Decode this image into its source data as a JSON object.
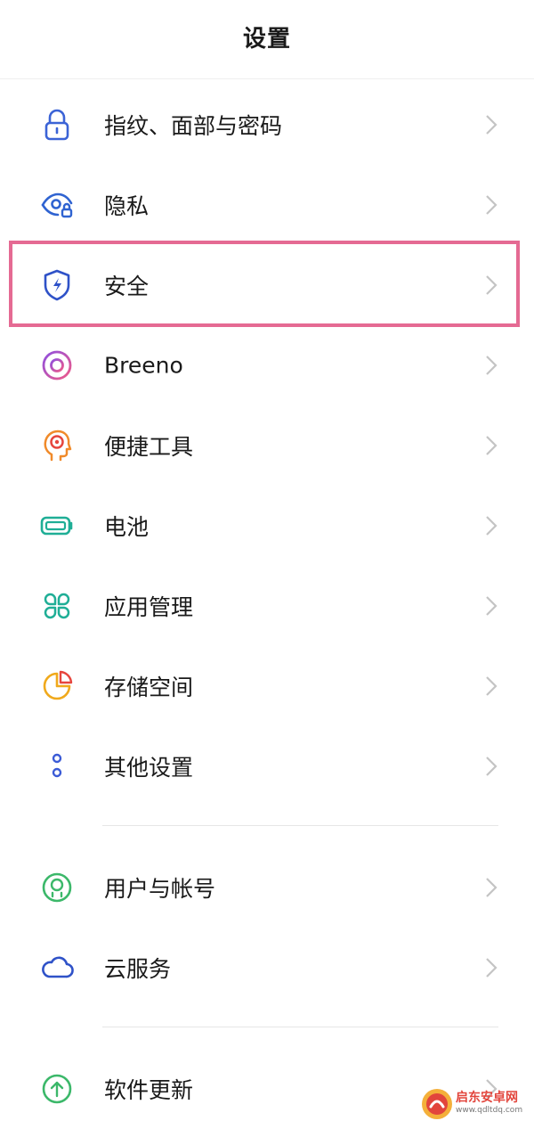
{
  "header": {
    "title": "设置"
  },
  "settings": {
    "items": [
      {
        "label": "指纹、面部与密码",
        "icon": "lock-icon",
        "color": "#3b63d6"
      },
      {
        "label": "隐私",
        "icon": "privacy-eye-icon",
        "color": "#2f63d1"
      },
      {
        "label": "安全",
        "icon": "shield-icon",
        "color": "#2f52c8"
      },
      {
        "label": "Breeno",
        "icon": "breeno-icon",
        "color": "#d94fa1"
      },
      {
        "label": "便捷工具",
        "icon": "head-tools-icon",
        "color": "#f08a2a"
      },
      {
        "label": "电池",
        "icon": "battery-icon",
        "color": "#1fae96"
      },
      {
        "label": "应用管理",
        "icon": "apps-grid-icon",
        "color": "#1fae96"
      },
      {
        "label": "存储空间",
        "icon": "storage-pie-icon",
        "color": "#f0a91c"
      },
      {
        "label": "其他设置",
        "icon": "more-dots-icon",
        "color": "#3b5bd6"
      },
      {
        "label": "用户与帐号",
        "icon": "user-icon",
        "color": "#3cb86a"
      },
      {
        "label": "云服务",
        "icon": "cloud-icon",
        "color": "#2f52c8"
      },
      {
        "label": "软件更新",
        "icon": "update-arrow-icon",
        "color": "#3cb86a"
      }
    ]
  },
  "highlight": {
    "color": "#e56a93"
  },
  "watermark": {
    "title": "启东安卓网",
    "url": "www.qdltdq.com",
    "color": "#e2453c"
  }
}
